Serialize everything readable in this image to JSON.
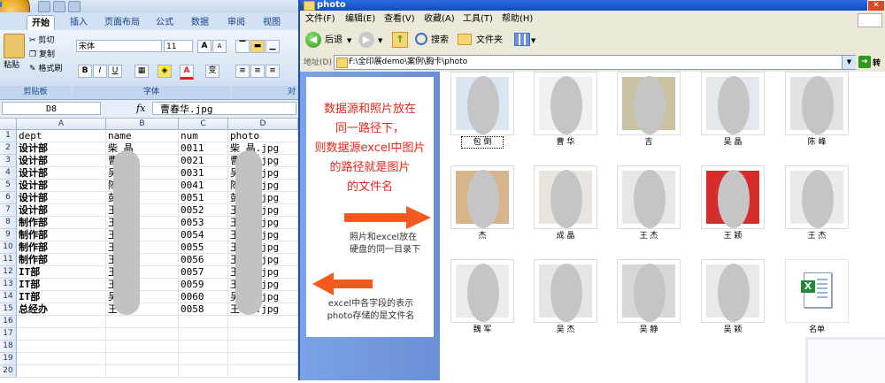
{
  "excel": {
    "tabs": [
      "开始",
      "插入",
      "页面布局",
      "公式",
      "数据",
      "审阅",
      "视图"
    ],
    "clipboard": {
      "paste": "粘贴",
      "cut": "剪切",
      "copy": "复制",
      "format_painter": "格式刷",
      "group": "剪贴板"
    },
    "font": {
      "name": "宋体",
      "size": "11",
      "grow": "A",
      "shrink": "A",
      "bold": "B",
      "italic": "I",
      "underline": "U",
      "color_letter": "A",
      "phonetic": "变",
      "group": "字体"
    },
    "align_group_label": "对",
    "name_box": "D8",
    "fx": "fx",
    "formula": "曹春华.jpg",
    "columns": [
      "A",
      "B",
      "C",
      "D"
    ],
    "rows": [
      {
        "n": "1",
        "a": "dept",
        "b": "name",
        "c": "num",
        "d": "photo"
      },
      {
        "n": "2",
        "a": "设计部",
        "b": "柴  晶",
        "c": "0011",
        "d": "柴  晶.jpg"
      },
      {
        "n": "3",
        "a": "设计部",
        "b": "曹  倒",
        "c": "0021",
        "d": "曹  倒.jpg"
      },
      {
        "n": "4",
        "a": "设计部",
        "b": "吴  晶",
        "c": "0031",
        "d": "吴  晶.jpg"
      },
      {
        "n": "5",
        "a": "设计部",
        "b": "陈  峰",
        "c": "0041",
        "d": "陈  峰.jpg"
      },
      {
        "n": "6",
        "a": "设计部",
        "b": "彭  峰",
        "c": "0051",
        "d": "彭  峰.jpg"
      },
      {
        "n": "7",
        "a": "设计部",
        "b": "王  杰",
        "c": "0052",
        "d": "王  杰.jpg"
      },
      {
        "n": "8",
        "a": "制作部",
        "b": "王  杰",
        "c": "0053",
        "d": "王  杰.jpg"
      },
      {
        "n": "9",
        "a": "制作部",
        "b": "王  杰",
        "c": "0054",
        "d": "王  杰.jpg"
      },
      {
        "n": "10",
        "a": "制作部",
        "b": "王  杰",
        "c": "0055",
        "d": "王  杰.jpg"
      },
      {
        "n": "11",
        "a": "制作部",
        "b": "王  杰",
        "c": "0056",
        "d": "王  杰.jpg"
      },
      {
        "n": "12",
        "a": "IT部",
        "b": "王  杰",
        "c": "0057",
        "d": "王  杰.jpg"
      },
      {
        "n": "13",
        "a": "IT部",
        "b": "王  杰",
        "c": "0059",
        "d": "王  杰.jpg"
      },
      {
        "n": "14",
        "a": "IT部",
        "b": "吴  杰",
        "c": "0060",
        "d": "吴  杰.jpg"
      },
      {
        "n": "15",
        "a": "总经办",
        "b": "王  颖",
        "c": "0058",
        "d": "王  颖.jpg"
      },
      {
        "n": "16",
        "a": "",
        "b": "",
        "c": "",
        "d": ""
      },
      {
        "n": "17",
        "a": "",
        "b": "",
        "c": "",
        "d": ""
      },
      {
        "n": "18",
        "a": "",
        "b": "",
        "c": "",
        "d": ""
      },
      {
        "n": "19",
        "a": "",
        "b": "",
        "c": "",
        "d": ""
      },
      {
        "n": "20",
        "a": "",
        "b": "",
        "c": "",
        "d": ""
      }
    ]
  },
  "explorer": {
    "title": "photo",
    "menu": [
      "文件(F)",
      "编辑(E)",
      "查看(V)",
      "收藏(A)",
      "工具(T)",
      "帮助(H)"
    ],
    "toolbar": {
      "back": "后退",
      "search": "搜索",
      "folders": "文件夹"
    },
    "address_label": "地址(D)",
    "address": "F:\\全印展demo\\案例\\胸卡\\photo",
    "go": "转",
    "note_title_lines": [
      "数据源和照片放在",
      "同一路径下，",
      "则数据源excel中图片",
      "的路径就是图片",
      "的文件名"
    ],
    "note_mid": [
      "照片和excel放在",
      "硬盘的同一目录下"
    ],
    "note_bottom": [
      "excel中各字段的表示",
      "photo存储的是文件名"
    ],
    "accent_color": "#e8241a",
    "files": [
      {
        "caption": "包  倒"
      },
      {
        "caption": "曹  华"
      },
      {
        "caption": "  吉  "
      },
      {
        "caption": "吴  晶"
      },
      {
        "caption": "陈  峰"
      },
      {
        "caption": "  杰"
      },
      {
        "caption": "成  晶"
      },
      {
        "caption": "王  杰"
      },
      {
        "caption": "王  颖"
      },
      {
        "caption": "王  杰"
      },
      {
        "caption": "魏  军"
      },
      {
        "caption": "吴  杰"
      },
      {
        "caption": "吴  静"
      },
      {
        "caption": "吴  颖"
      },
      {
        "caption": "名单"
      }
    ]
  }
}
